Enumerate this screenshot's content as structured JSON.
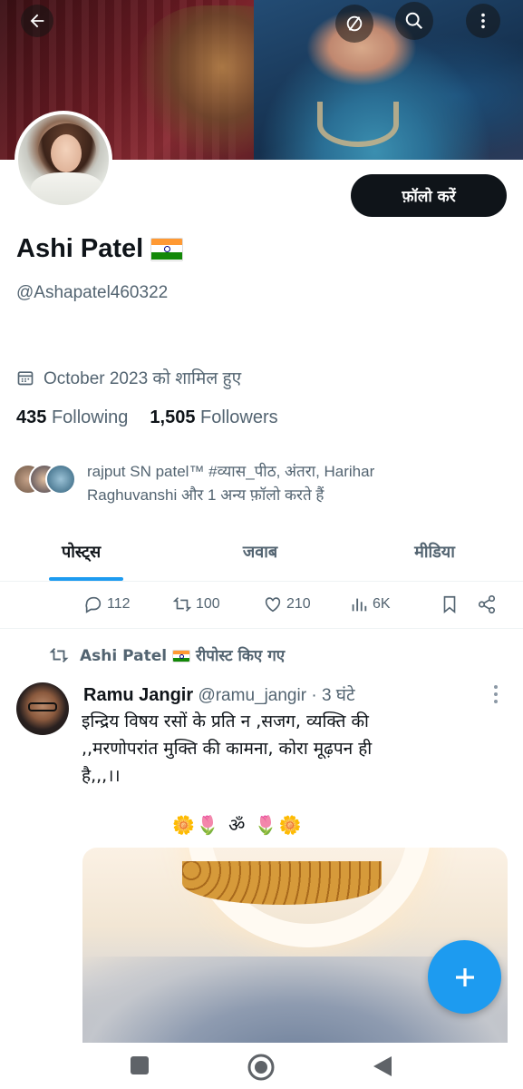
{
  "header": {
    "back_icon": "arrow-left-icon",
    "circle_slash_icon": "circle-slash-icon",
    "search_icon": "search-icon",
    "more_icon": "more-vertical-icon"
  },
  "profile": {
    "follow_label": "फ़ॉलो करें",
    "name": "Ashi Patel",
    "name_flag": "india-flag",
    "handle": "@Ashapatel460322",
    "joined": "October 2023 को शामिल हुए",
    "following_count": "435",
    "following_label": "Following",
    "followers_count": "1,505",
    "followers_label": "Followers",
    "followed_by": "rajput SN patel™ #व्यास_पीठ, अंतरा, Harihar Raghuvanshi और 1 अन्य फ़ॉलो करते हैं"
  },
  "tabs": [
    {
      "label": "पोस्ट्स",
      "active": true
    },
    {
      "label": "जवाब",
      "active": false
    },
    {
      "label": "मीडिया",
      "active": false
    }
  ],
  "prev_tweet_actions": {
    "replies": "112",
    "reposts": "100",
    "likes": "210",
    "views": "6K"
  },
  "repost": {
    "by": "Ashi Patel",
    "suffix": "रीपोस्ट किए गए"
  },
  "tweet": {
    "author": "Ramu Jangir",
    "handle": "@ramu_jangir",
    "time": "· 3 घंटे",
    "text": "इन्द्रिय विषय रसों के प्रति न ,सजग, व्यक्ति की ,,मरणोपरांत मुक्ति की कामना, कोरा मूढ़पन ही है,,,।।",
    "emoji_line": "🌼🌷 ॐ 🌷🌼"
  },
  "colors": {
    "accent": "#1d9bf0",
    "text_primary": "#0f1419",
    "text_secondary": "#536471"
  }
}
